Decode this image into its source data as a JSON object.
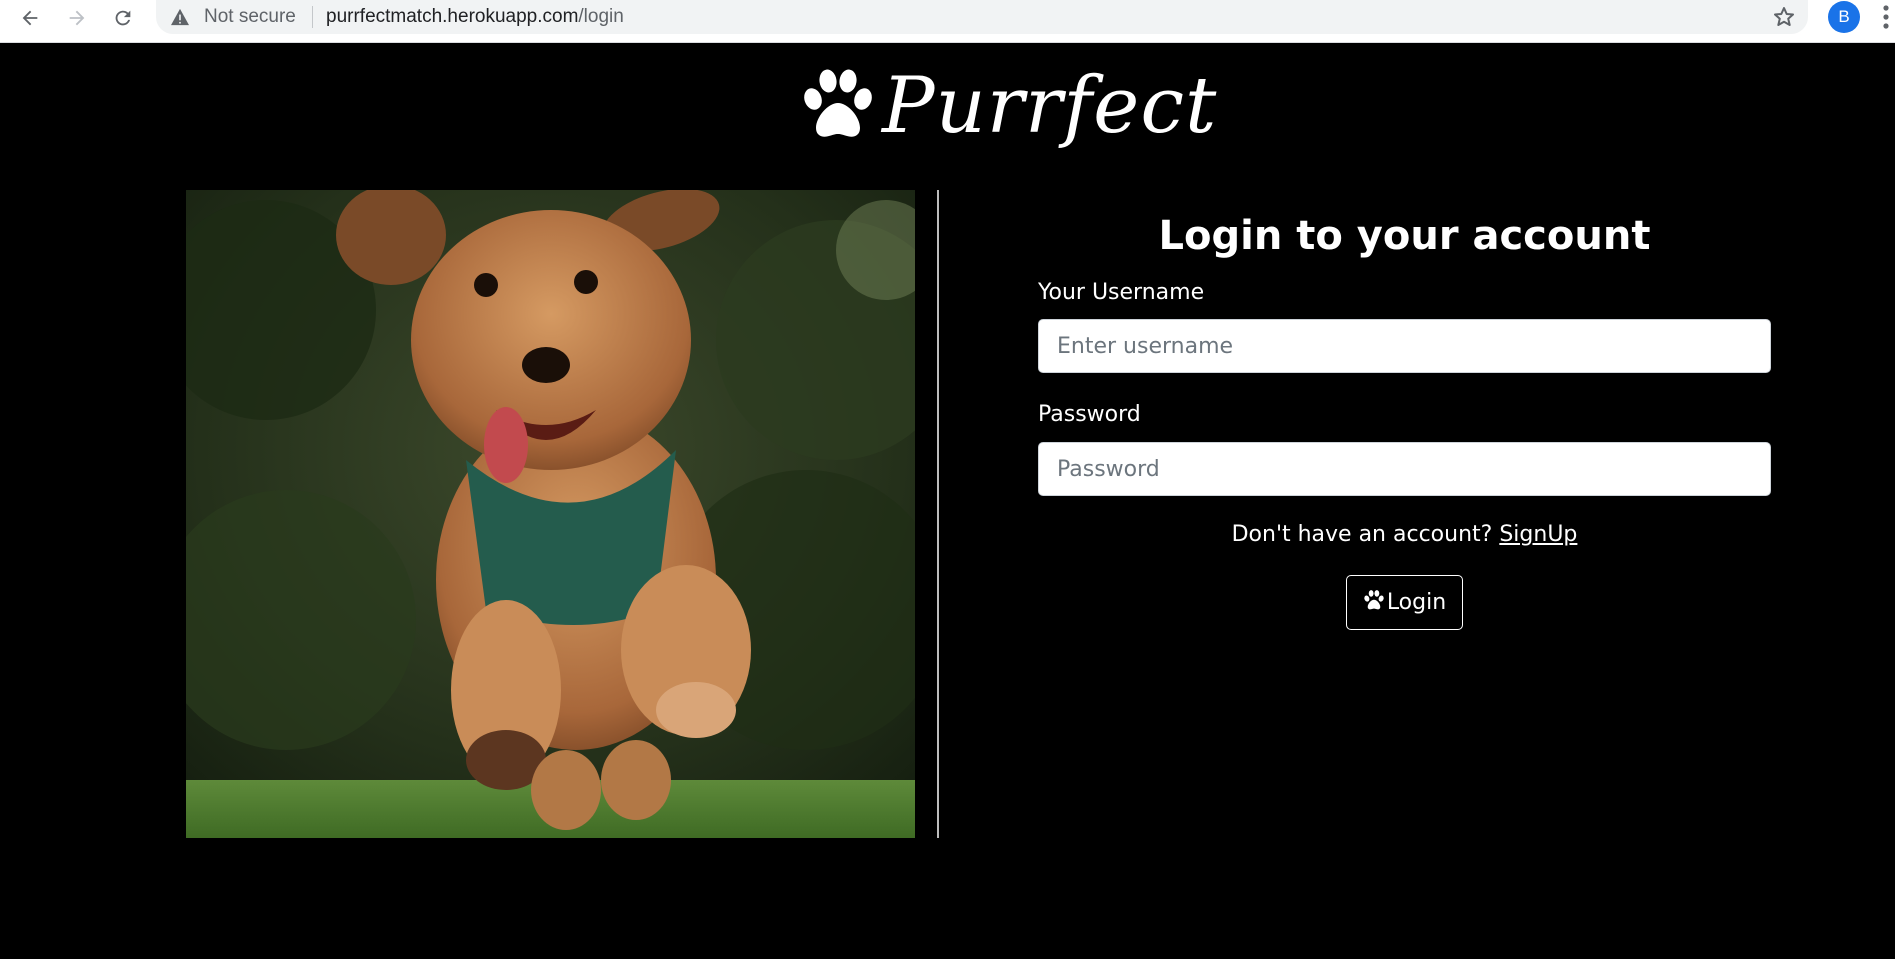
{
  "browser": {
    "security_label": "Not secure",
    "url_host": "purrfectmatch.herokuapp.com",
    "url_path": "/login",
    "profile_initial": "B",
    "icons": [
      "back-arrow-icon",
      "forward-arrow-icon",
      "reload-icon",
      "warning-icon",
      "star-icon",
      "more-vert-icon"
    ]
  },
  "page": {
    "logo_text": "Purrfect",
    "title": "Login to your account",
    "username_label": "Your Username",
    "username_placeholder": "Enter username",
    "username_value": "",
    "password_label": "Password",
    "password_placeholder": "Password",
    "password_value": "",
    "signup_prompt": "Don't have an account?",
    "signup_link": "SignUp",
    "login_button": "Login"
  },
  "colors": {
    "background": "#000000",
    "text": "#ffffff",
    "chrome_accent": "#1a73e8"
  }
}
